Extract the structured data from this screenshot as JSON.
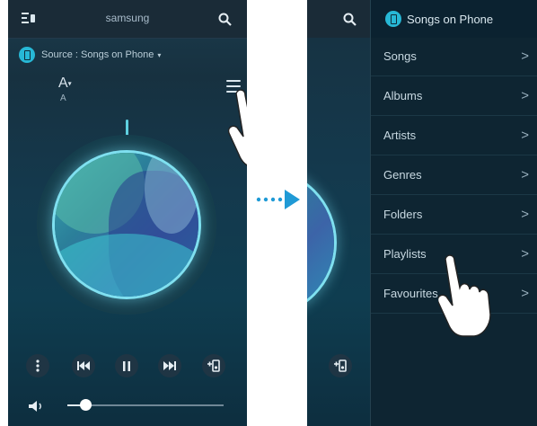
{
  "left_screen": {
    "header": {
      "title": "samsung"
    },
    "source": {
      "label": "Source : Songs on Phone"
    },
    "sort": {
      "letter": "A",
      "sub_letter": "A"
    }
  },
  "arrow": {
    "description": ""
  },
  "right_screen": {
    "drawer": {
      "title": "Songs on Phone",
      "items": [
        {
          "label": "Songs",
          "chevron": ">"
        },
        {
          "label": "Albums",
          "chevron": ">"
        },
        {
          "label": "Artists",
          "chevron": ">"
        },
        {
          "label": "Genres",
          "chevron": ">"
        },
        {
          "label": "Folders",
          "chevron": ">"
        },
        {
          "label": "Playlists",
          "chevron": ">"
        },
        {
          "label": "Favourites",
          "chevron": ">"
        }
      ]
    }
  }
}
